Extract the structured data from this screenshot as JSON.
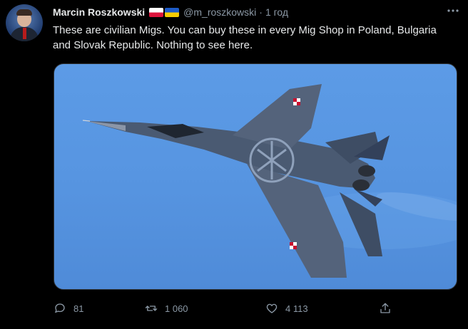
{
  "tweet": {
    "author_name": "Marcin Roszkowski",
    "handle": "@m_roszkowski",
    "separator": "·",
    "time": "1 год",
    "text": "These are civilian Migs. You can buy these in every Mig Shop in Poland, Bulgaria and Slovak Republic. Nothing to see here.",
    "more_icon": "more-icon",
    "flags": [
      "poland-flag-icon",
      "ukraine-flag-icon"
    ]
  },
  "media": {
    "subject": "fighter-jet",
    "sky_color": "#5795e1",
    "jet_color": "#4a5a72"
  },
  "actions": {
    "reply_count": "81",
    "retweet_count": "1 060",
    "like_count": "4 113",
    "icons": [
      "reply-icon",
      "retweet-icon",
      "like-icon",
      "share-icon"
    ]
  },
  "colors": {
    "background": "#000000",
    "text": "#e7e9ea",
    "muted": "#8b98a5"
  }
}
